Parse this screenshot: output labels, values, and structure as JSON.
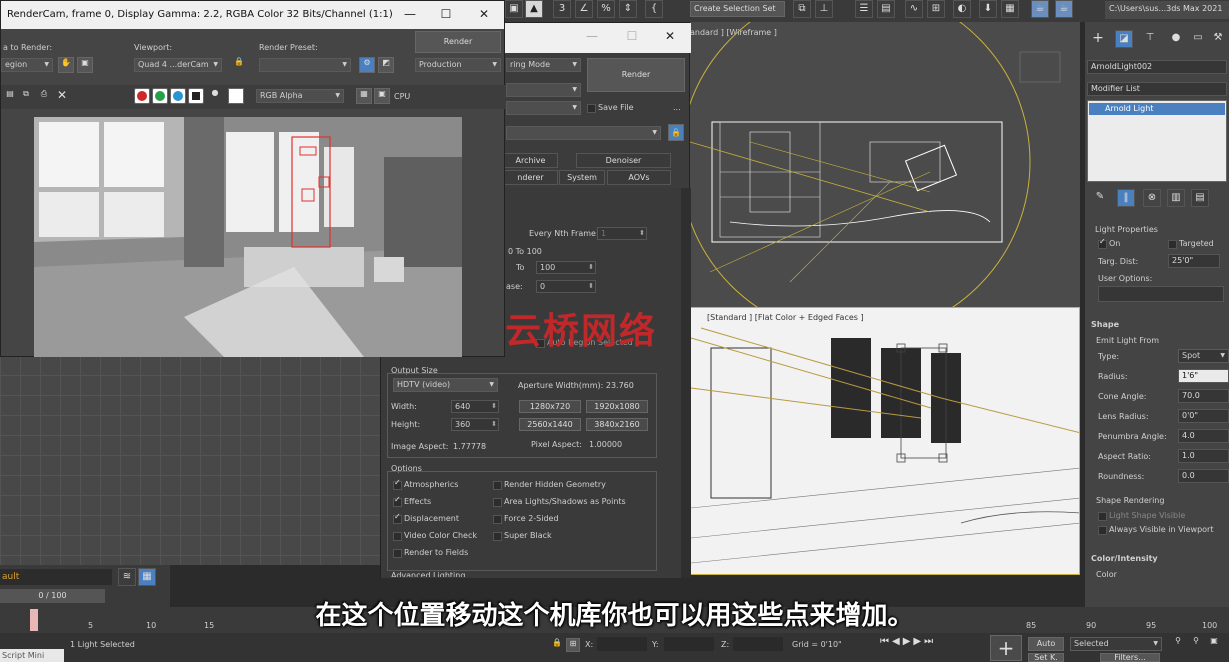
{
  "toolbar": {
    "create_selection_set": "Create Selection Set",
    "path": "C:\\Users\\sus...3ds Max 2021",
    "snap_label": "3",
    "percent_label": "%"
  },
  "render_frame": {
    "title": "RenderCam, frame 0, Display Gamma: 2.2, RGBA Color 32 Bits/Channel (1:1)",
    "area_to_render_label": "a to Render:",
    "area_value": "egion",
    "viewport_label": "Viewport:",
    "viewport_value": "Quad 4 ...derCam",
    "preset_label": "Render Preset:",
    "preset_value": "",
    "render_button": "Render",
    "production_value": "Production",
    "channel_value": "RGB Alpha",
    "cpu_label": "CPU"
  },
  "render_setup": {
    "mode_value": "ring Mode",
    "render_button": "Render",
    "save_file": "Save File",
    "ellipsis": "...",
    "tabs_row1": [
      "Archive",
      "Denoiser"
    ],
    "tabs_row2": [
      "nderer",
      "System",
      "AOVs"
    ],
    "every_nth_label": "Every Nth Frame:",
    "every_nth_value": "1",
    "range_text": "0 To 100",
    "to_label": "To",
    "to_value": "100",
    "base_label": "ase:",
    "base_value": "0",
    "auto_region": "Auto Region Selected",
    "output_size_label": "Output Size",
    "output_preset": "HDTV (video)",
    "aperture_label": "Aperture Width(mm): 23.760",
    "width_label": "Width:",
    "width_value": "640",
    "height_label": "Height:",
    "height_value": "360",
    "res_buttons": [
      "1280x720",
      "1920x1080",
      "2560x1440",
      "3840x2160"
    ],
    "image_aspect_label": "Image Aspect:",
    "image_aspect_value": "1.77778",
    "pixel_aspect_label": "Pixel Aspect:",
    "pixel_aspect_value": "1.00000",
    "options_label": "Options",
    "options_left": [
      {
        "label": "Atmospherics",
        "checked": true
      },
      {
        "label": "Effects",
        "checked": true
      },
      {
        "label": "Displacement",
        "checked": true
      },
      {
        "label": "Video Color Check",
        "checked": false
      },
      {
        "label": "Render to Fields",
        "checked": false
      }
    ],
    "options_right": [
      {
        "label": "Render Hidden Geometry",
        "checked": false
      },
      {
        "label": "Area Lights/Shadows as Points",
        "checked": false
      },
      {
        "label": "Force 2-Sided",
        "checked": false
      },
      {
        "label": "Super Black",
        "checked": false
      }
    ],
    "advanced_lighting": "Advanced Lighting"
  },
  "viewports": {
    "top_label": "andard ] [Wireframe ]",
    "persp_label": "[Standard ] [Flat Color + Edged Faces ]"
  },
  "command_panel": {
    "object_name": "ArnoldLight002",
    "modifier_list": "Modifier List",
    "stack_item": "Arnold Light",
    "light_properties": "Light Properties",
    "on_label": "On",
    "on_checked": true,
    "targeted_label": "Targeted",
    "targeted_checked": false,
    "targ_dist_label": "Targ. Dist:",
    "targ_dist_value": "25'0\"",
    "user_options_label": "User Options:",
    "shape_header": "Shape",
    "emit_light_from": "Emit Light From",
    "type_label": "Type:",
    "type_value": "Spot",
    "radius_label": "Radius:",
    "radius_value": "1'6\"",
    "cone_angle_label": "Cone Angle:",
    "cone_angle_value": "70.0",
    "lens_radius_label": "Lens Radius:",
    "lens_radius_value": "0'0\"",
    "penumbra_label": "Penumbra Angle:",
    "penumbra_value": "4.0",
    "aspect_label": "Aspect Ratio:",
    "aspect_value": "1.0",
    "roundness_label": "Roundness:",
    "roundness_value": "0.0",
    "shape_rendering": "Shape Rendering",
    "light_shape_visible": "Light Shape Visible",
    "always_visible": "Always Visible in Viewport",
    "color_intensity_header": "Color/Intensity",
    "color_label": "Color"
  },
  "left_panel": {
    "layer_value": "ault",
    "frame_counter": "0 / 100"
  },
  "timeline": {
    "ticks": [
      "5",
      "10",
      "15",
      "85",
      "90",
      "95",
      "100"
    ]
  },
  "status": {
    "selection": "1 Light Selected",
    "x_label": "X:",
    "y_label": "Y:",
    "z_label": "Z:",
    "grid": "Grid = 0'10\"",
    "auto_label": "Auto",
    "selected_value": "Selected",
    "set_key": "Set K.",
    "filters": "Filters...",
    "script": "Script Mini"
  },
  "subtitle": "在这个位置移动这个机库你也可以用这些点来增加。",
  "watermark": "云桥网络",
  "colors": {
    "panel_bg": "#444444",
    "accent_blue": "#4a7fc0",
    "watermark_red": "#c0282a",
    "selection_yellow": "#c9b23a"
  }
}
